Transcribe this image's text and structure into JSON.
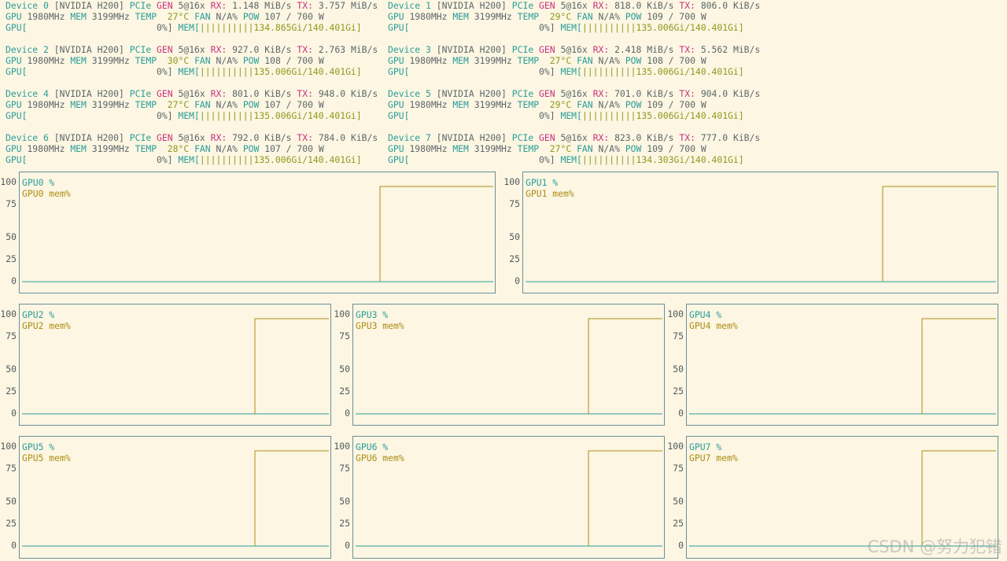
{
  "devices": [
    {
      "label": "Device 0",
      "model": "[NVIDIA H200]",
      "pcie": "PCIe",
      "gen": "GEN",
      "link": "5@16x",
      "rx_label": "RX:",
      "rx": "1.148 MiB/s",
      "tx_label": "TX:",
      "tx": "3.757 MiB/s",
      "gpu_label": "GPU",
      "gpu_clock": "1980MHz",
      "mem_label": "MEM",
      "mem_clock": "3199MHz",
      "temp_label": "TEMP",
      "temp": "27°C",
      "fan_label": "FAN",
      "fan": "N/A%",
      "pow_label": "POW",
      "pow": "107 / 700 W",
      "util_prefix": "GPU[",
      "util": "0%]",
      "membar_label": "MEM[",
      "membar": "||||||||||134.865Gi/140.401Gi]"
    },
    {
      "label": "Device 1",
      "model": "[NVIDIA H200]",
      "pcie": "PCIe",
      "gen": "GEN",
      "link": "5@16x",
      "rx_label": "RX:",
      "rx": "818.0 KiB/s",
      "tx_label": "TX:",
      "tx": "806.0 KiB/s",
      "gpu_label": "GPU",
      "gpu_clock": "1980MHz",
      "mem_label": "MEM",
      "mem_clock": "3199MHz",
      "temp_label": "TEMP",
      "temp": "29°C",
      "fan_label": "FAN",
      "fan": "N/A%",
      "pow_label": "POW",
      "pow": "109 / 700 W",
      "util_prefix": "GPU[",
      "util": "0%]",
      "membar_label": "MEM[",
      "membar": "||||||||||135.006Gi/140.401Gi]"
    },
    {
      "label": "Device 2",
      "model": "[NVIDIA H200]",
      "pcie": "PCIe",
      "gen": "GEN",
      "link": "5@16x",
      "rx_label": "RX:",
      "rx": "927.0 KiB/s",
      "tx_label": "TX:",
      "tx": "2.763 MiB/s",
      "gpu_label": "GPU",
      "gpu_clock": "1980MHz",
      "mem_label": "MEM",
      "mem_clock": "3199MHz",
      "temp_label": "TEMP",
      "temp": "30°C",
      "fan_label": "FAN",
      "fan": "N/A%",
      "pow_label": "POW",
      "pow": "108 / 700 W",
      "util_prefix": "GPU[",
      "util": "0%]",
      "membar_label": "MEM[",
      "membar": "||||||||||135.006Gi/140.401Gi]"
    },
    {
      "label": "Device 3",
      "model": "[NVIDIA H200]",
      "pcie": "PCIe",
      "gen": "GEN",
      "link": "5@16x",
      "rx_label": "RX:",
      "rx": "2.418 MiB/s",
      "tx_label": "TX:",
      "tx": "5.562 MiB/s",
      "gpu_label": "GPU",
      "gpu_clock": "1980MHz",
      "mem_label": "MEM",
      "mem_clock": "3199MHz",
      "temp_label": "TEMP",
      "temp": "27°C",
      "fan_label": "FAN",
      "fan": "N/A%",
      "pow_label": "POW",
      "pow": "108 / 700 W",
      "util_prefix": "GPU[",
      "util": "0%]",
      "membar_label": "MEM[",
      "membar": "||||||||||135.006Gi/140.401Gi]"
    },
    {
      "label": "Device 4",
      "model": "[NVIDIA H200]",
      "pcie": "PCIe",
      "gen": "GEN",
      "link": "5@16x",
      "rx_label": "RX:",
      "rx": "801.0 KiB/s",
      "tx_label": "TX:",
      "tx": "948.0 KiB/s",
      "gpu_label": "GPU",
      "gpu_clock": "1980MHz",
      "mem_label": "MEM",
      "mem_clock": "3199MHz",
      "temp_label": "TEMP",
      "temp": "27°C",
      "fan_label": "FAN",
      "fan": "N/A%",
      "pow_label": "POW",
      "pow": "107 / 700 W",
      "util_prefix": "GPU[",
      "util": "0%]",
      "membar_label": "MEM[",
      "membar": "||||||||||135.006Gi/140.401Gi]"
    },
    {
      "label": "Device 5",
      "model": "[NVIDIA H200]",
      "pcie": "PCIe",
      "gen": "GEN",
      "link": "5@16x",
      "rx_label": "RX:",
      "rx": "701.0 KiB/s",
      "tx_label": "TX:",
      "tx": "904.0 KiB/s",
      "gpu_label": "GPU",
      "gpu_clock": "1980MHz",
      "mem_label": "MEM",
      "mem_clock": "3199MHz",
      "temp_label": "TEMP",
      "temp": "29°C",
      "fan_label": "FAN",
      "fan": "N/A%",
      "pow_label": "POW",
      "pow": "109 / 700 W",
      "util_prefix": "GPU[",
      "util": "0%]",
      "membar_label": "MEM[",
      "membar": "||||||||||135.006Gi/140.401Gi]"
    },
    {
      "label": "Device 6",
      "model": "[NVIDIA H200]",
      "pcie": "PCIe",
      "gen": "GEN",
      "link": "5@16x",
      "rx_label": "RX:",
      "rx": "792.0 KiB/s",
      "tx_label": "TX:",
      "tx": "784.0 KiB/s",
      "gpu_label": "GPU",
      "gpu_clock": "1980MHz",
      "mem_label": "MEM",
      "mem_clock": "3199MHz",
      "temp_label": "TEMP",
      "temp": "28°C",
      "fan_label": "FAN",
      "fan": "N/A%",
      "pow_label": "POW",
      "pow": "107 / 700 W",
      "util_prefix": "GPU[",
      "util": "0%]",
      "membar_label": "MEM[",
      "membar": "||||||||||135.006Gi/140.401Gi]"
    },
    {
      "label": "Device 7",
      "model": "[NVIDIA H200]",
      "pcie": "PCIe",
      "gen": "GEN",
      "link": "5@16x",
      "rx_label": "RX:",
      "rx": "823.0 KiB/s",
      "tx_label": "TX:",
      "tx": "777.0 KiB/s",
      "gpu_label": "GPU",
      "gpu_clock": "1980MHz",
      "mem_label": "MEM",
      "mem_clock": "3199MHz",
      "temp_label": "TEMP",
      "temp": "27°C",
      "fan_label": "FAN",
      "fan": "N/A%",
      "pow_label": "POW",
      "pow": "109 / 700 W",
      "util_prefix": "GPU[",
      "util": "0%]",
      "membar_label": "MEM[",
      "membar": "||||||||||134.303Gi/140.401Gi]"
    }
  ],
  "chart_data": [
    {
      "type": "line",
      "gpu": "GPU0",
      "series": [
        {
          "name": "GPU0 %",
          "values": [
            0,
            0
          ]
        },
        {
          "name": "GPU0 mem%",
          "values": [
            0,
            96
          ]
        }
      ],
      "yticks": [
        "100",
        "75",
        "50",
        "25",
        "0"
      ],
      "ylim": [
        0,
        100
      ]
    },
    {
      "type": "line",
      "gpu": "GPU1",
      "series": [
        {
          "name": "GPU1 %",
          "values": [
            0,
            0
          ]
        },
        {
          "name": "GPU1 mem%",
          "values": [
            0,
            96
          ]
        }
      ],
      "yticks": [
        "100",
        "75",
        "50",
        "25",
        "0"
      ],
      "ylim": [
        0,
        100
      ]
    },
    {
      "type": "line",
      "gpu": "GPU2",
      "series": [
        {
          "name": "GPU2 %",
          "values": [
            0,
            0
          ]
        },
        {
          "name": "GPU2 mem%",
          "values": [
            0,
            96
          ]
        }
      ],
      "yticks": [
        "100",
        "75",
        "50",
        "25",
        "0"
      ],
      "ylim": [
        0,
        100
      ]
    },
    {
      "type": "line",
      "gpu": "GPU3",
      "series": [
        {
          "name": "GPU3 %",
          "values": [
            0,
            0
          ]
        },
        {
          "name": "GPU3 mem%",
          "values": [
            0,
            96
          ]
        }
      ],
      "yticks": [
        "100",
        "75",
        "50",
        "25",
        "0"
      ],
      "ylim": [
        0,
        100
      ]
    },
    {
      "type": "line",
      "gpu": "GPU4",
      "series": [
        {
          "name": "GPU4 %",
          "values": [
            0,
            0
          ]
        },
        {
          "name": "GPU4 mem%",
          "values": [
            0,
            96
          ]
        }
      ],
      "yticks": [
        "100",
        "75",
        "50",
        "25",
        "0"
      ],
      "ylim": [
        0,
        100
      ]
    },
    {
      "type": "line",
      "gpu": "GPU5",
      "series": [
        {
          "name": "GPU5 %",
          "values": [
            0,
            0
          ]
        },
        {
          "name": "GPU5 mem%",
          "values": [
            0,
            96
          ]
        }
      ],
      "yticks": [
        "100",
        "75",
        "50",
        "25",
        "0"
      ],
      "ylim": [
        0,
        100
      ]
    },
    {
      "type": "line",
      "gpu": "GPU6",
      "series": [
        {
          "name": "GPU6 %",
          "values": [
            0,
            0
          ]
        },
        {
          "name": "GPU6 mem%",
          "values": [
            0,
            96
          ]
        }
      ],
      "yticks": [
        "100",
        "75",
        "50",
        "25",
        "0"
      ],
      "ylim": [
        0,
        100
      ]
    },
    {
      "type": "line",
      "gpu": "GPU7",
      "series": [
        {
          "name": "GPU7 %",
          "values": [
            0,
            0
          ]
        },
        {
          "name": "GPU7 mem%",
          "values": [
            0,
            96
          ]
        }
      ],
      "yticks": [
        "100",
        "75",
        "50",
        "25",
        "0"
      ],
      "ylim": [
        0,
        100
      ]
    }
  ],
  "colors": {
    "background": "#fcf6e3",
    "cyan": "#2a9d97",
    "magenta": "#c8327f",
    "olive": "#8d9a1d",
    "mem_line": "#ad8d14",
    "util_line": "#2a9d97",
    "border": "#6b8f98"
  },
  "watermark": "CSDN @努力犯错"
}
